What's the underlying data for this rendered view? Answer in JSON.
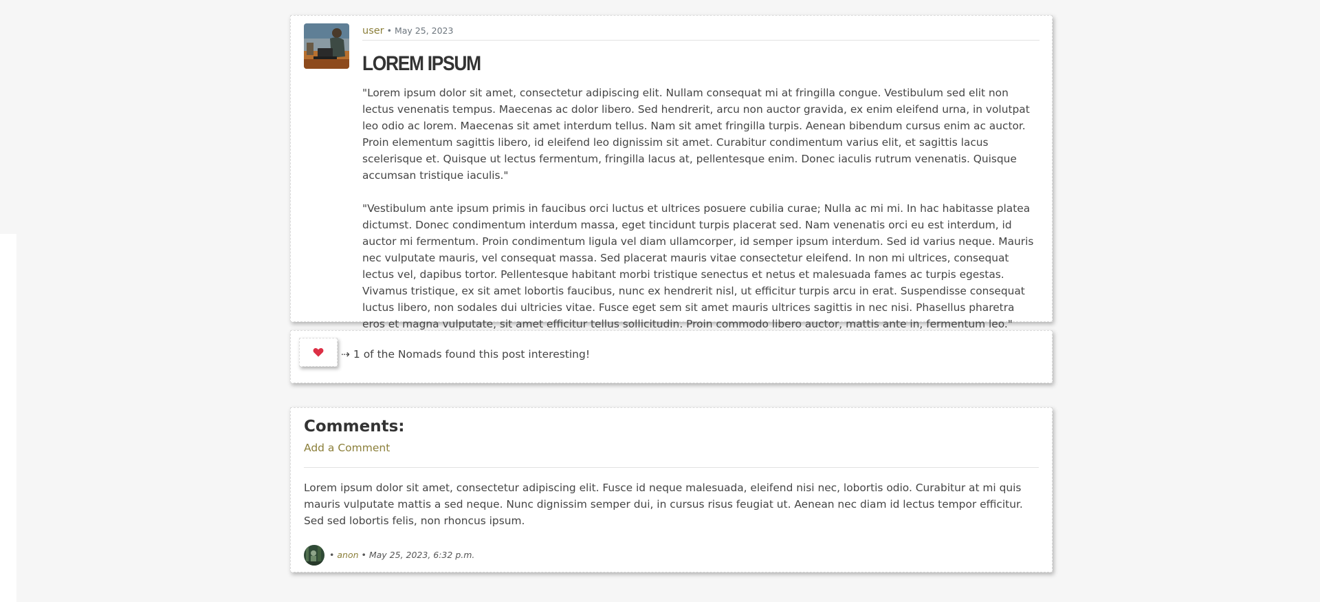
{
  "post": {
    "username": "user",
    "separator": "•",
    "date": "May 25, 2023",
    "title": "LOREM IPSUM",
    "paragraphs": [
      "\"Lorem ipsum dolor sit amet, consectetur adipiscing elit. Nullam consequat mi at fringilla congue. Vestibulum sed elit non lectus venenatis tempus. Maecenas ac dolor libero. Sed hendrerit, arcu non auctor gravida, ex enim eleifend urna, in volutpat leo odio ac lorem. Maecenas sit amet interdum tellus. Nam sit amet fringilla turpis. Aenean bibendum cursus enim ac auctor. Proin elementum sagittis libero, id eleifend leo dignissim sit amet. Curabitur condimentum varius elit, et sagittis lacus scelerisque et. Quisque ut lectus fermentum, fringilla lacus at, pellentesque enim. Donec iaculis rutrum venenatis. Quisque accumsan tristique iaculis.\"",
      "\"Vestibulum ante ipsum primis in faucibus orci luctus et ultrices posuere cubilia curae; Nulla ac mi mi. In hac habitasse platea dictumst. Donec condimentum interdum massa, eget tincidunt turpis placerat sed. Nam venenatis orci eu est interdum, id auctor mi fermentum. Proin condimentum ligula vel diam ullamcorper, id semper ipsum interdum. Sed id varius neque. Mauris nec vulputate mauris, vel consequat massa. Sed placerat mauris vitae consectetur eleifend. In non mi ultrices, consequat lectus vel, dapibus tortor. Pellentesque habitant morbi tristique senectus et netus et malesuada fames ac turpis egestas. Vivamus tristique, ex sit amet lobortis faucibus, nunc ex hendrerit nisl, ut efficitur turpis arcu in erat. Suspendisse consequat luctus libero, non sodales dui ultricies vitae. Fusce eget sem sit amet mauris ultrices sagittis in nec nisi. Phasellus pharetra eros et magna vulputate, sit amet efficitur tellus sollicitudin. Proin commodo libero auctor, mattis ante in, fermentum leo.\""
    ]
  },
  "like": {
    "icon": "heart-icon",
    "text": "⇢ 1 of the Nomads found this post interesting!"
  },
  "comments": {
    "heading": "Comments:",
    "add_label": "Add a Comment",
    "items": [
      {
        "text": "Lorem ipsum dolor sit amet, consectetur adipiscing elit. Fusce id neque malesuada, eleifend nisi nec, lobortis odio. Curabitur at mi quis mauris vulputate mattis a sed neque. Nunc dignissim semper dui, in cursus risus feugiat ut. Aenean nec diam id lectus tempor efficitur. Sed sed lobortis felis, non rhoncus ipsum.",
        "prefix": "•",
        "author": "anon",
        "datetime": "• May 25, 2023, 6:32 p.m."
      }
    ]
  },
  "colors": {
    "accent": "#8b7f3a",
    "heart": "#dc2f45",
    "background": "#f6f6f6"
  }
}
